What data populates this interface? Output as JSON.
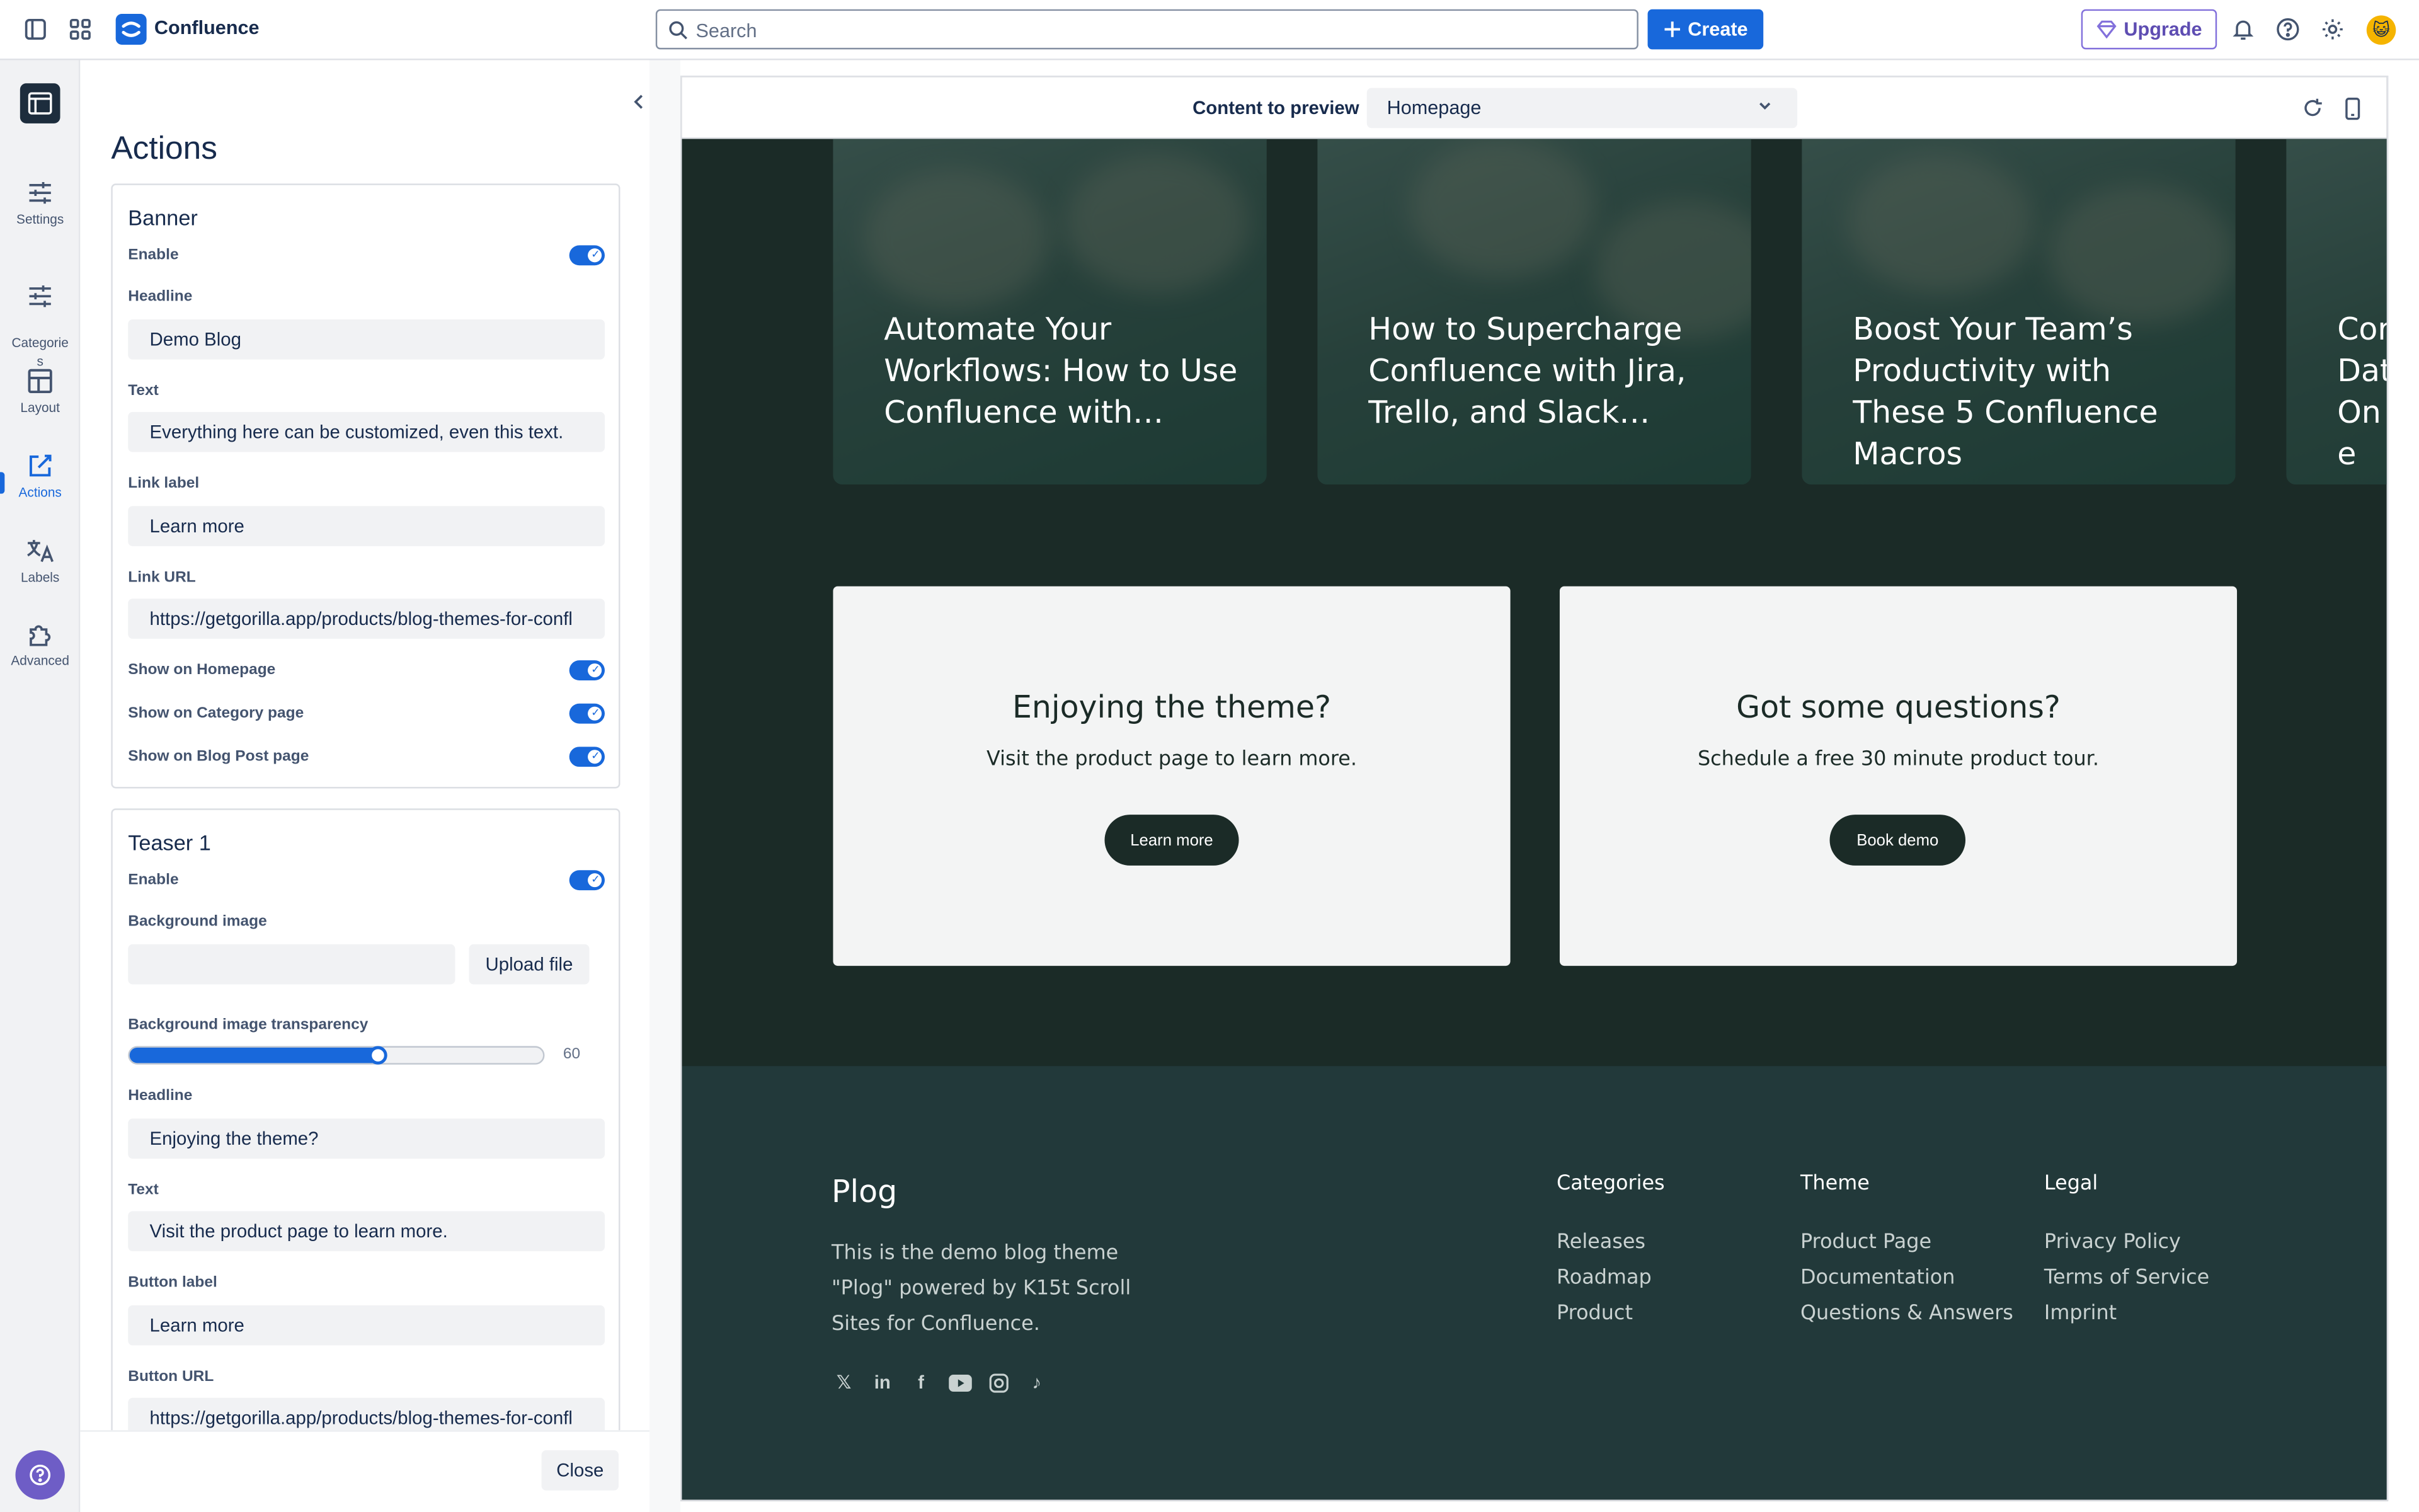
{
  "app": {
    "name": "Confluence"
  },
  "topbar": {
    "search_placeholder": "Search",
    "create_label": "Create",
    "upgrade_label": "Upgrade",
    "accent": "#1868db",
    "upgrade_color": "#5e4db2"
  },
  "rail": {
    "items": [
      {
        "label": "Settings",
        "icon": "sliders-icon"
      },
      {
        "label": "Categorie\ns",
        "icon": "sliders-icon"
      },
      {
        "label": "Layout",
        "icon": "layout-icon"
      },
      {
        "label": "Actions",
        "icon": "edit-icon",
        "active": true
      },
      {
        "label": "Labels",
        "icon": "translate-icon"
      },
      {
        "label": "Advanced",
        "icon": "puzzle-icon"
      }
    ]
  },
  "panel": {
    "title": "Actions",
    "banner": {
      "title": "Banner",
      "enable_label": "Enable",
      "headline_label": "Headline",
      "headline_value": "Demo Blog",
      "text_label": "Text",
      "text_value": "Everything here can be customized, even this text.",
      "link_label_label": "Link label",
      "link_label_value": "Learn more",
      "link_url_label": "Link URL",
      "link_url_value": "https://getgorilla.app/products/blog-themes-for-confl",
      "show_homepage": "Show on Homepage",
      "show_category": "Show on Category page",
      "show_blogpost": "Show on Blog Post page"
    },
    "teaser1": {
      "title": "Teaser 1",
      "enable_label": "Enable",
      "bg_image_label": "Background image",
      "upload_label": "Upload file",
      "transparency_label": "Background image transparency",
      "transparency_value": "60",
      "transparency_fraction": 0.6,
      "headline_label": "Headline",
      "headline_value": "Enjoying the theme?",
      "text_label": "Text",
      "text_value": "Visit the product page to learn more.",
      "button_label_label": "Button label",
      "button_label_value": "Learn more",
      "button_url_label": "Button URL",
      "button_url_value": "https://getgorilla.app/products/blog-themes-for-confl"
    },
    "close_label": "Close"
  },
  "preview": {
    "content_label": "Content to preview",
    "content_value": "Homepage",
    "hero_cards": [
      "Automate Your Workflows: How to Use Confluence with…",
      "How to Supercharge Confluence with Jira, Trello, and Slack…",
      "Boost Your Team’s Productivity with These 5 Confluence Macros",
      "Cor Dat One"
    ],
    "cta": [
      {
        "title": "Enjoying the theme?",
        "text": "Visit the product page to learn more.",
        "button": "Learn more"
      },
      {
        "title": "Got some questions?",
        "text": "Schedule a free 30 minute product tour.",
        "button": "Book demo"
      }
    ],
    "footer": {
      "brand": "Plog",
      "description": "This is the demo blog theme \"Plog\" powered by K15t Scroll Sites for Confluence.",
      "socials": [
        "x-icon",
        "linkedin-icon",
        "facebook-icon",
        "youtube-icon",
        "instagram-icon",
        "tiktok-icon"
      ],
      "columns": [
        {
          "title": "Categories",
          "links": [
            "Releases",
            "Roadmap",
            "Product"
          ]
        },
        {
          "title": "Theme",
          "links": [
            "Product Page",
            "Documentation",
            "Questions & Answers"
          ]
        },
        {
          "title": "Legal",
          "links": [
            "Privacy Policy",
            "Terms of Service",
            "Imprint"
          ]
        }
      ],
      "bg_color": "#22393a"
    },
    "bg_color": "#1b2b27"
  }
}
